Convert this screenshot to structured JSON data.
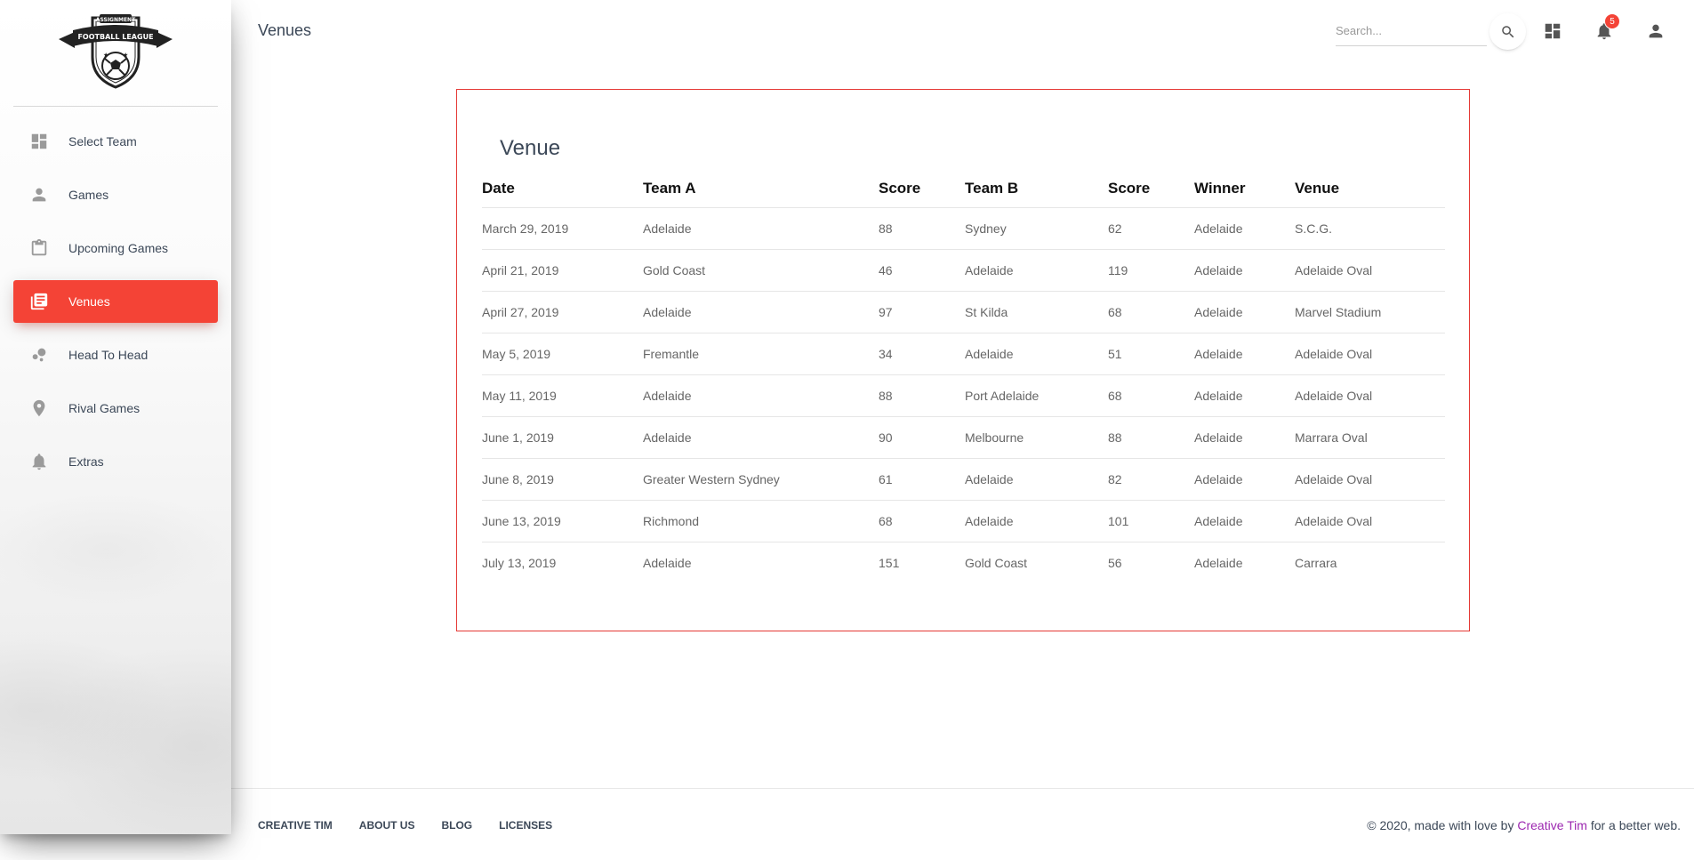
{
  "logo": {
    "top_text": "ASSIGNMENT",
    "banner_text": "FOOTBALL LEAGUE"
  },
  "sidebar": {
    "items": [
      {
        "label": "Select Team",
        "icon": "dashboard-icon"
      },
      {
        "label": "Games",
        "icon": "person-icon"
      },
      {
        "label": "Upcoming Games",
        "icon": "clipboard-icon"
      },
      {
        "label": "Venues",
        "icon": "library-books-icon",
        "active": true
      },
      {
        "label": "Head To Head",
        "icon": "bubble-chart-icon"
      },
      {
        "label": "Rival Games",
        "icon": "location-pin-icon"
      },
      {
        "label": "Extras",
        "icon": "notifications-icon"
      }
    ]
  },
  "header": {
    "title": "Venues",
    "search_placeholder": "Search...",
    "notification_count": "5"
  },
  "card": {
    "title": "Venue",
    "columns": [
      "Date",
      "Team A",
      "Score",
      "Team B",
      "Score",
      "Winner",
      "Venue"
    ],
    "rows": [
      [
        "March 29, 2019",
        "Adelaide",
        "88",
        "Sydney",
        "62",
        "Adelaide",
        "S.C.G."
      ],
      [
        "April 21, 2019",
        "Gold Coast",
        "46",
        "Adelaide",
        "119",
        "Adelaide",
        "Adelaide Oval"
      ],
      [
        "April 27, 2019",
        "Adelaide",
        "97",
        "St Kilda",
        "68",
        "Adelaide",
        "Marvel Stadium"
      ],
      [
        "May 5, 2019",
        "Fremantle",
        "34",
        "Adelaide",
        "51",
        "Adelaide",
        "Adelaide Oval"
      ],
      [
        "May 11, 2019",
        "Adelaide",
        "88",
        "Port Adelaide",
        "68",
        "Adelaide",
        "Adelaide Oval"
      ],
      [
        "June 1, 2019",
        "Adelaide",
        "90",
        "Melbourne",
        "88",
        "Adelaide",
        "Marrara Oval"
      ],
      [
        "June 8, 2019",
        "Greater Western Sydney",
        "61",
        "Adelaide",
        "82",
        "Adelaide",
        "Adelaide Oval"
      ],
      [
        "June 13, 2019",
        "Richmond",
        "68",
        "Adelaide",
        "101",
        "Adelaide",
        "Adelaide Oval"
      ],
      [
        "July 13, 2019",
        "Adelaide",
        "151",
        "Gold Coast",
        "56",
        "Adelaide",
        "Carrara"
      ]
    ]
  },
  "footer": {
    "links": [
      "CREATIVE TIM",
      "ABOUT US",
      "BLOG",
      "LICENSES"
    ],
    "copyright_prefix": "© 2020, made with love by ",
    "copyright_brand": "Creative Tim",
    "copyright_suffix": " for a better web."
  },
  "colors": {
    "accent": "#f44336",
    "card_border": "#e53935",
    "brand_link": "#9c27b0"
  }
}
